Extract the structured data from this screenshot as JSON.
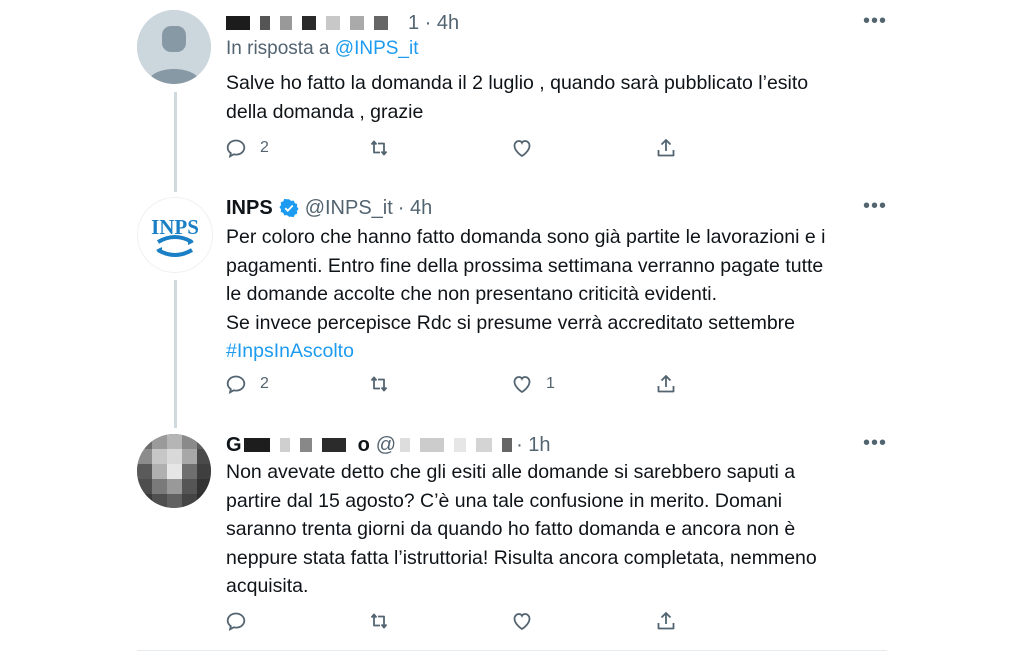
{
  "tweets": [
    {
      "handle": "",
      "time": "1 · 4h",
      "replying_prefix": "In risposta a",
      "replying_to": "@INPS_it",
      "lines": [
        "Salve ho fatto la domanda il  2 luglio , quando sarà pubblicato l’esito",
        "della domanda , grazie"
      ],
      "reply_count": "2",
      "retweet_count": "",
      "like_count": ""
    },
    {
      "name": "INPS",
      "handle": "@INPS_it",
      "time": "· 4h",
      "lines": [
        "Per coloro che hanno fatto domanda sono già partite le lavorazioni e i",
        "pagamenti. Entro fine della prossima settimana verranno pagate tutte",
        "le domande accolte che non presentano criticità evidenti.",
        "Se invece percepisce Rdc si presume verrà accreditato  settembre"
      ],
      "hashtag": "#InpsInAscolto",
      "logo_text": "INPS",
      "reply_count": "2",
      "retweet_count": "",
      "like_count": "1"
    },
    {
      "name_initial": "G",
      "handle_initial": "o",
      "at": "@",
      "time": "· 1h",
      "lines": [
        "Non avevate detto che gli esiti alle domande si sarebbero saputi a",
        "partire dal 15 agosto? C’è una tale confusione in merito. Domani",
        "saranno trenta giorni da quando ho fatto domanda e ancora non è",
        "neppure stata fatta l’istruttoria! Risulta ancora completata, nemmeno",
        "acquisita."
      ],
      "reply_count": "",
      "retweet_count": "",
      "like_count": ""
    }
  ],
  "icons": {
    "reply": "reply-icon",
    "retweet": "retweet-icon",
    "like": "heart-icon",
    "share": "share-icon",
    "more": "more-icon",
    "verified": "verified-badge-icon"
  },
  "colors": {
    "accent": "#1d9bf0",
    "muted": "#536471",
    "text": "#0f1419",
    "inps_blue": "#1a7fc4"
  }
}
